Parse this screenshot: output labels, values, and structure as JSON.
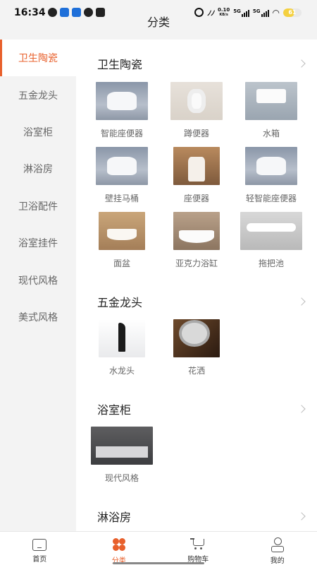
{
  "status_bar": {
    "time": "16:34",
    "net_speed_value": "0.10",
    "net_speed_unit": "KB/s",
    "signal_1": "5G",
    "signal_2": "5G",
    "battery": "61"
  },
  "header": {
    "title": "分类"
  },
  "sidebar": {
    "items": [
      {
        "label": "卫生陶瓷",
        "active": true
      },
      {
        "label": "五金龙头",
        "active": false
      },
      {
        "label": "浴室柜",
        "active": false
      },
      {
        "label": "淋浴房",
        "active": false
      },
      {
        "label": "卫浴配件",
        "active": false
      },
      {
        "label": "浴室挂件",
        "active": false
      },
      {
        "label": "现代风格",
        "active": false
      },
      {
        "label": "美式风格",
        "active": false
      }
    ]
  },
  "sections": [
    {
      "title": "卫生陶瓷",
      "products": [
        {
          "label": "智能座便器",
          "image": "smart-toilet"
        },
        {
          "label": "蹲便器",
          "image": "squat-toilet"
        },
        {
          "label": "水箱",
          "image": "water-tank"
        },
        {
          "label": "壁挂马桶",
          "image": "wall-hung-toilet"
        },
        {
          "label": "座便器",
          "image": "toilet"
        },
        {
          "label": "轻智能座便器",
          "image": "light-smart-toilet"
        },
        {
          "label": "面盆",
          "image": "basin"
        },
        {
          "label": "亚克力浴缸",
          "image": "acrylic-bathtub"
        },
        {
          "label": "拖把池",
          "image": "mop-sink"
        }
      ]
    },
    {
      "title": "五金龙头",
      "products": [
        {
          "label": "水龙头",
          "image": "faucet"
        },
        {
          "label": "花洒",
          "image": "shower-head"
        }
      ]
    },
    {
      "title": "浴室柜",
      "products": [
        {
          "label": "现代风格",
          "image": "modern-cabinet"
        }
      ]
    },
    {
      "title": "淋浴房",
      "products": []
    }
  ],
  "tabbar": {
    "items": [
      {
        "label": "首页",
        "icon": "home-icon",
        "active": false
      },
      {
        "label": "分类",
        "icon": "category-icon",
        "active": true
      },
      {
        "label": "购物车",
        "icon": "cart-icon",
        "active": false
      },
      {
        "label": "我的",
        "icon": "profile-icon",
        "active": false
      }
    ]
  },
  "colors": {
    "accent": "#e8602c",
    "sidebar_bg": "#f3f3f3"
  }
}
